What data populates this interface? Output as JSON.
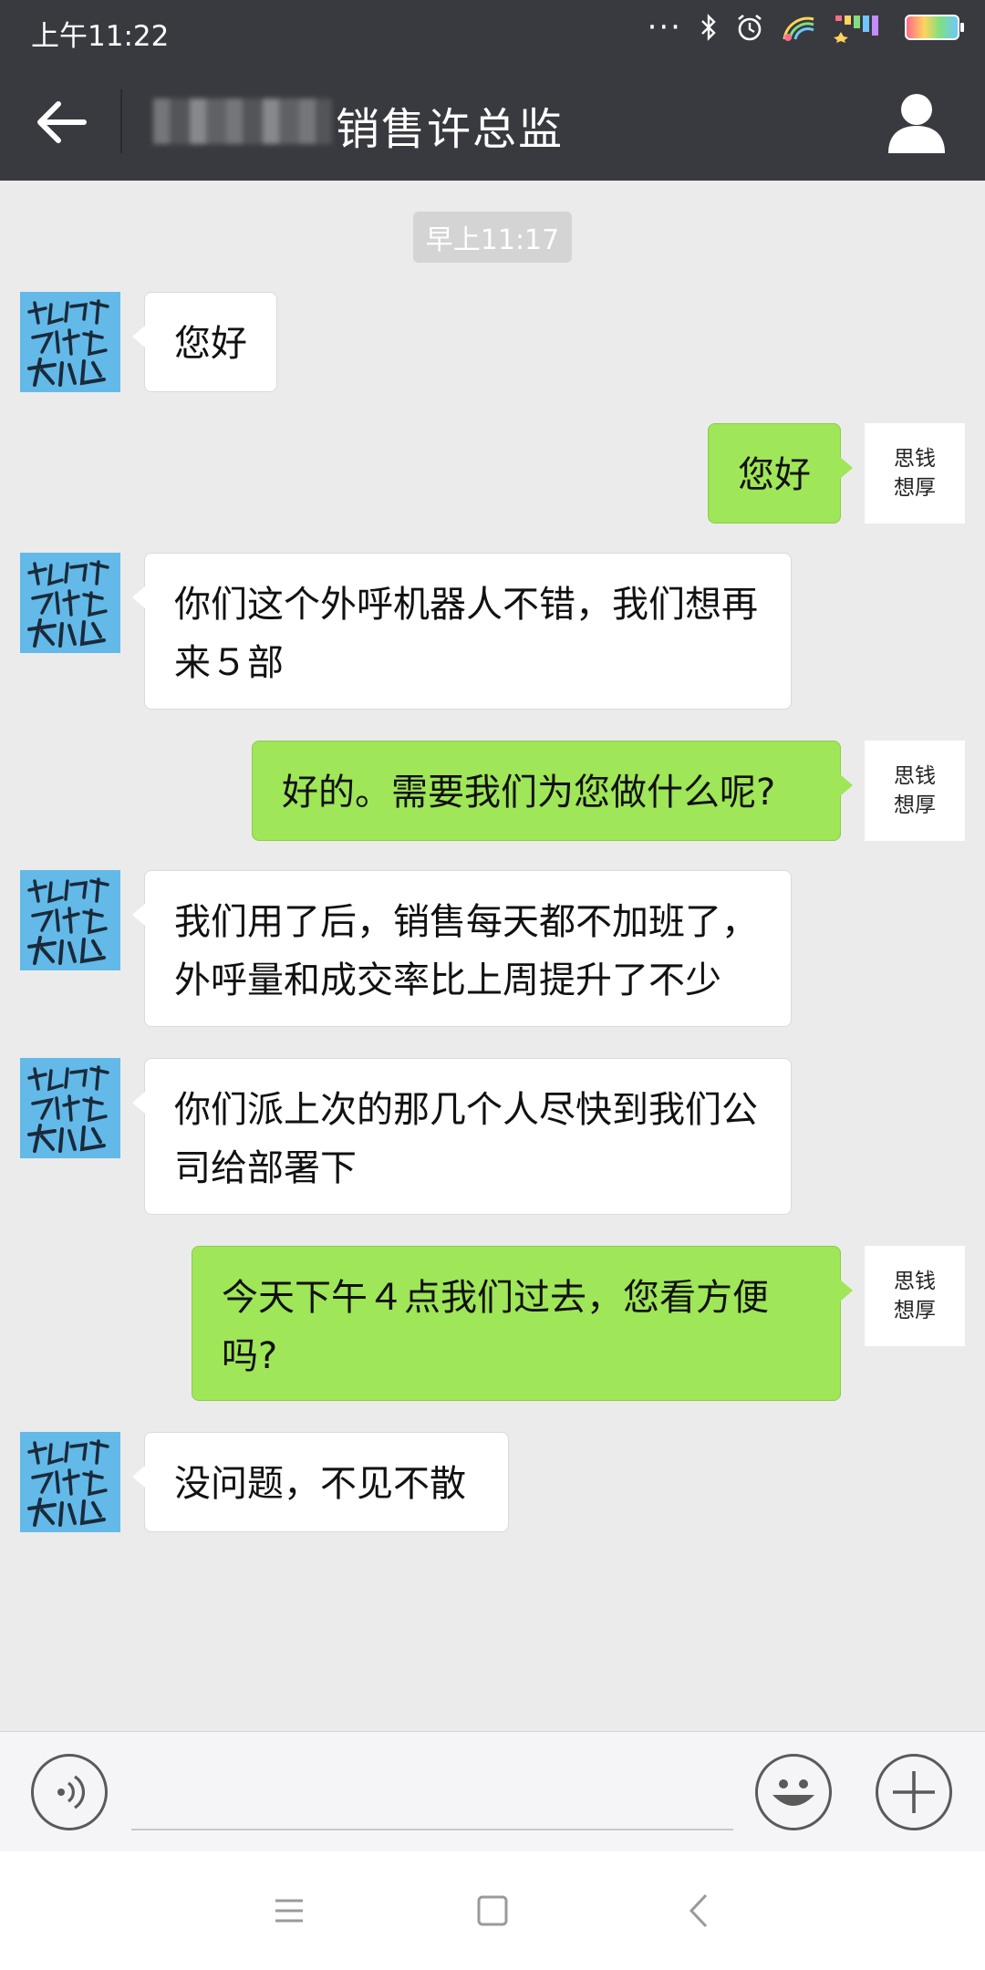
{
  "status_bar": {
    "time": "上午11:22",
    "icons": [
      "dots-icon",
      "bluetooth-icon",
      "alarm-icon",
      "wifi-icon",
      "signal-icon",
      "battery-icon"
    ]
  },
  "header": {
    "title": "销售许总监",
    "back_icon": "arrow-left-icon",
    "profile_icon": "person-icon"
  },
  "chat": {
    "timestamp": "早上11:17",
    "contact_avatar_text": "逆风而上 才练得出 大心脏",
    "self_avatar_text": "思钱\n想厚",
    "messages": [
      {
        "side": "in",
        "text": "您好"
      },
      {
        "side": "out",
        "text": "您好"
      },
      {
        "side": "in",
        "text": "你们这个外呼机器人不错，我们想再来５部"
      },
      {
        "side": "out",
        "text": "好的。需要我们为您做什么呢?"
      },
      {
        "side": "in",
        "text": "我们用了后，销售每天都不加班了，外呼量和成交率比上周提升了不少"
      },
      {
        "side": "in",
        "text": "你们派上次的那几个人尽快到我们公司给部署下"
      },
      {
        "side": "out",
        "text": "今天下午４点我们过去，您看方便吗?"
      },
      {
        "side": "in",
        "text": "没问题，不见不散"
      }
    ]
  },
  "input_bar": {
    "voice_icon": "voice-icon",
    "emoji_icon": "smiley-icon",
    "more_icon": "plus-icon"
  },
  "nav_bar": {
    "icons": [
      "menu-icon",
      "home-square-icon",
      "back-chevron-icon"
    ]
  },
  "colors": {
    "header_bg": "#393a3f",
    "chat_bg": "#ebebeb",
    "outgoing_bubble": "#9fe658",
    "incoming_bubble": "#ffffff",
    "contact_avatar_bg": "#63b9e8"
  }
}
